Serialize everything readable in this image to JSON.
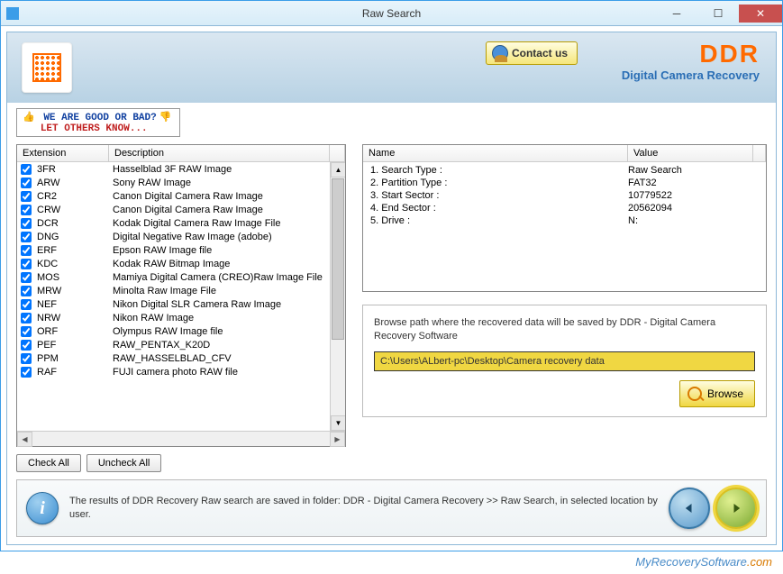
{
  "window": {
    "title": "Raw Search"
  },
  "header": {
    "contact_label": "Contact us",
    "brand": "DDR",
    "brand_sub": "Digital Camera Recovery"
  },
  "banner": {
    "line1": "WE ARE GOOD OR BAD?",
    "line2": "LET OTHERS KNOW..."
  },
  "left": {
    "col_ext": "Extension",
    "col_desc": "Description",
    "rows": [
      {
        "ext": "3FR",
        "desc": "Hasselblad 3F RAW Image"
      },
      {
        "ext": "ARW",
        "desc": "Sony RAW Image"
      },
      {
        "ext": "CR2",
        "desc": "Canon Digital Camera Raw Image"
      },
      {
        "ext": "CRW",
        "desc": "Canon Digital Camera Raw Image"
      },
      {
        "ext": "DCR",
        "desc": "Kodak Digital Camera Raw Image File"
      },
      {
        "ext": "DNG",
        "desc": "Digital Negative Raw Image (adobe)"
      },
      {
        "ext": "ERF",
        "desc": "Epson RAW Image file"
      },
      {
        "ext": "KDC",
        "desc": "Kodak RAW Bitmap Image"
      },
      {
        "ext": "MOS",
        "desc": "Mamiya Digital Camera (CREO)Raw Image File"
      },
      {
        "ext": "MRW",
        "desc": "Minolta Raw Image File"
      },
      {
        "ext": "NEF",
        "desc": "Nikon Digital SLR Camera Raw Image"
      },
      {
        "ext": "NRW",
        "desc": "Nikon RAW Image"
      },
      {
        "ext": "ORF",
        "desc": "Olympus RAW Image file"
      },
      {
        "ext": "PEF",
        "desc": "RAW_PENTAX_K20D"
      },
      {
        "ext": "PPM",
        "desc": "RAW_HASSELBLAD_CFV"
      },
      {
        "ext": "RAF",
        "desc": "FUJI camera photo RAW file"
      }
    ],
    "check_all": "Check All",
    "uncheck_all": "Uncheck All"
  },
  "info": {
    "col_name": "Name",
    "col_value": "Value",
    "rows": [
      {
        "n": "1. Search Type :",
        "v": "Raw Search"
      },
      {
        "n": "2. Partition Type :",
        "v": "FAT32"
      },
      {
        "n": "3. Start Sector :",
        "v": "10779522"
      },
      {
        "n": "4. End Sector :",
        "v": "20562094"
      },
      {
        "n": "5. Drive :",
        "v": "N:"
      }
    ]
  },
  "browse": {
    "label": "Browse path where the recovered data will be saved by DDR - Digital Camera Recovery Software",
    "path": "C:\\Users\\ALbert-pc\\Desktop\\Camera recovery data",
    "button": "Browse"
  },
  "footer": {
    "text": "The results of DDR Recovery Raw search are saved in folder: DDR - Digital Camera Recovery  >> Raw Search, in selected location by user."
  },
  "watermark": {
    "a": "MyRecoverySoftware",
    "b": ".com"
  }
}
